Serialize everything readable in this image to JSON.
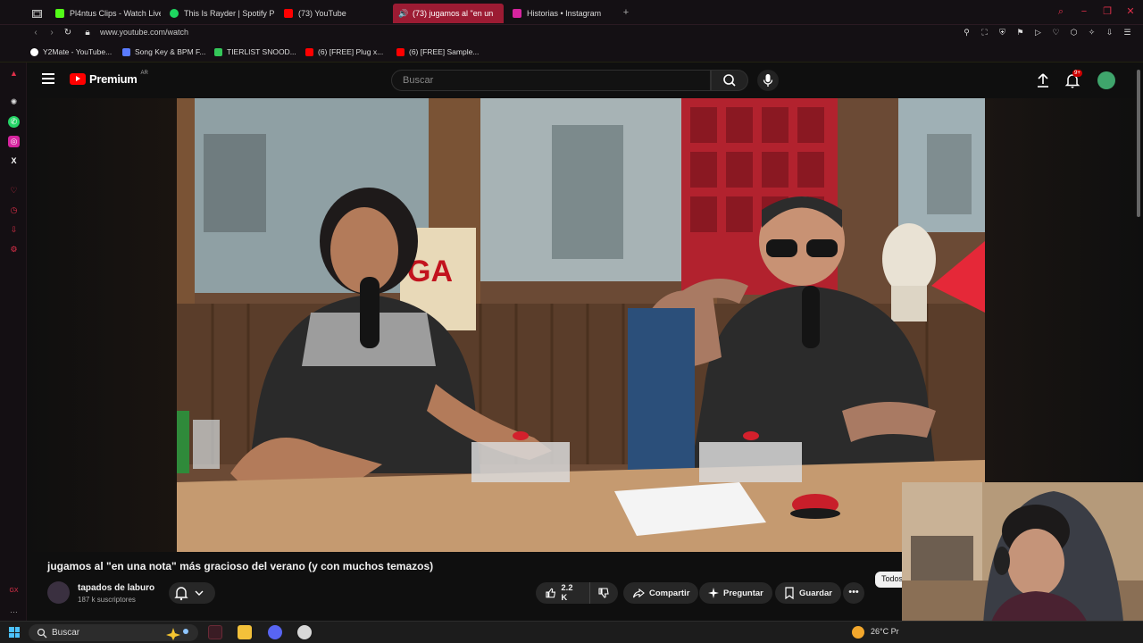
{
  "browser": {
    "tabs": [
      {
        "label": "Pl4ntus Clips - Watch Live",
        "color": "#53fc18",
        "active": false
      },
      {
        "label": "This Is Rayder | Spotify Pl",
        "color": "#1ed760",
        "active": false
      },
      {
        "label": "(73) YouTube",
        "color": "#ff0000",
        "active": false
      },
      {
        "label": "(73) jugamos al \"en un",
        "color": "#ff0000",
        "active": true
      },
      {
        "label": "Historias • Instagram",
        "color": "#d6249f",
        "active": false
      }
    ],
    "url": "www.youtube.com/watch",
    "bookmarks": [
      {
        "label": "Y2Mate - YouTube...",
        "color": "#ffffff"
      },
      {
        "label": "Song Key & BPM F...",
        "color": "#5a7bff"
      },
      {
        "label": "TIERLIST SNOOD...",
        "color": "#34c759"
      },
      {
        "label": "(6) [FREE] Plug x...",
        "color": "#ff0000"
      },
      {
        "label": "(6) [FREE] Sample...",
        "color": "#ff0000"
      }
    ],
    "accent": "#e0304a"
  },
  "youtube": {
    "brand": "Premium",
    "region": "AR",
    "search_placeholder": "Buscar",
    "notifications": "9+",
    "video": {
      "title": "jugamos al \"en una nota\" más gracioso del verano (y con muchos temazos)",
      "channel": "tapados de laburo",
      "subscribers": "187 k suscriptores",
      "likes": "2.2 K",
      "share_label": "Compartir",
      "ask_label": "Preguntar",
      "save_label": "Guardar",
      "chip_label": "Todos"
    }
  },
  "taskbar": {
    "search_label": "Buscar",
    "weather": "26°C",
    "weather_suffix": "Pr"
  }
}
